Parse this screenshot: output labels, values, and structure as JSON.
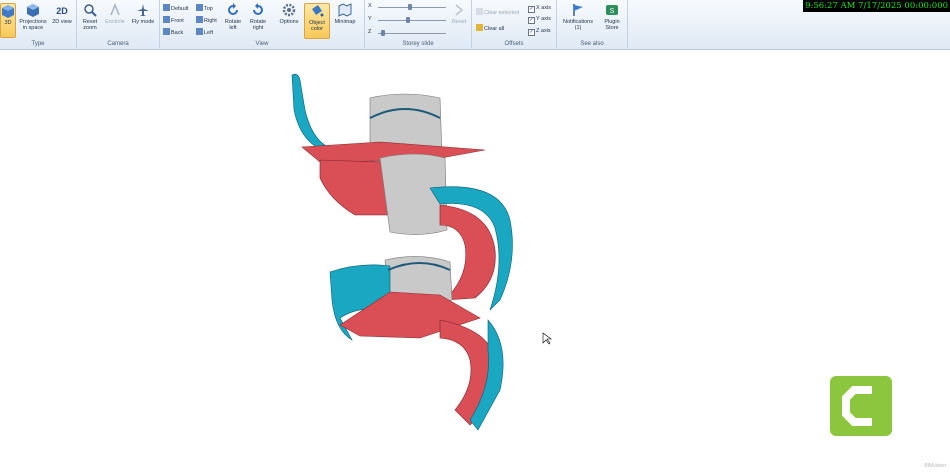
{
  "clock": "9:56:27 AM 7/17/2025 00:00:000",
  "ribbon": {
    "type_group": {
      "label": "Type",
      "buttons": [
        "3D",
        "Projections in space",
        "2D view"
      ]
    },
    "camera_group": {
      "label": "Camera",
      "buttons": [
        "Reset zoom",
        "Encircle",
        "Fly mode"
      ]
    },
    "view_group": {
      "label": "View",
      "small": [
        "Default",
        "Front",
        "Back",
        "Top",
        "Right",
        "Left"
      ],
      "buttons": [
        "Rotate left",
        "Rotate right",
        "Options",
        "Object color",
        "Minimap"
      ]
    },
    "storey_group": {
      "label": "Storey slide",
      "axes": [
        "X",
        "Y",
        "Z"
      ],
      "reset": "Reset",
      "levels": [
        0.45,
        0.42,
        0.18
      ]
    },
    "offsets_group": {
      "label": "Offsets",
      "clear_selected": "Clear selected",
      "clear_all": "Clear all",
      "checks": [
        "X axis",
        "Y axis",
        "Z axis"
      ]
    },
    "seealso_group": {
      "label": "See also",
      "buttons": [
        "Notifications (1)",
        "Plugin Store"
      ]
    }
  },
  "watermark": "BIMvision",
  "colors": {
    "riser": "#c9c9c9",
    "tread": "#d94f55",
    "rail": "#1aa7c2",
    "dark": "#1c5a78"
  }
}
